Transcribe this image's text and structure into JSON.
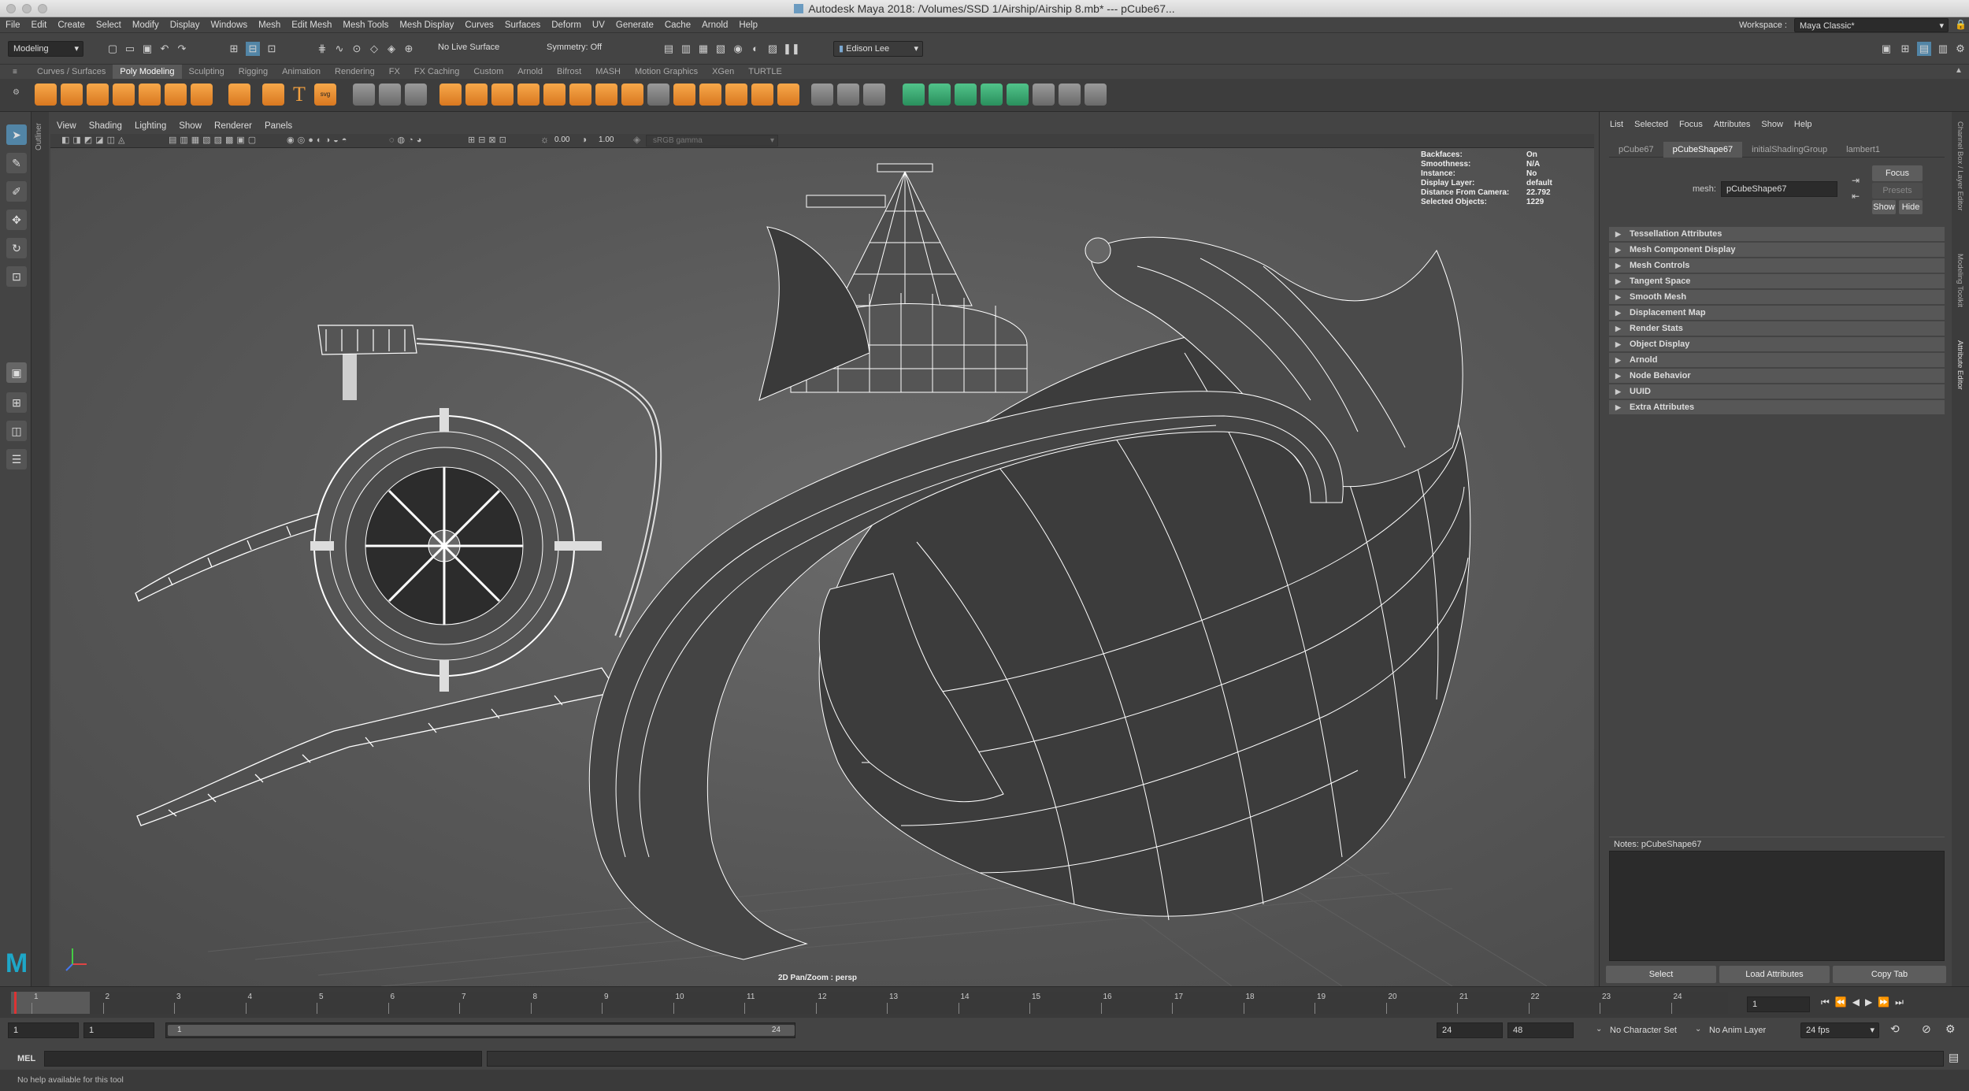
{
  "window": {
    "title": "Autodesk Maya 2018: /Volumes/SSD 1/Airship/Airship 8.mb*   ---   pCube67..."
  },
  "menubar": [
    "File",
    "Edit",
    "Create",
    "Select",
    "Modify",
    "Display",
    "Windows",
    "Mesh",
    "Edit Mesh",
    "Mesh Tools",
    "Mesh Display",
    "Curves",
    "Surfaces",
    "Deform",
    "UV",
    "Generate",
    "Cache",
    "Arnold",
    "Help"
  ],
  "workspace": {
    "label": "Workspace :",
    "value": "Maya Classic*"
  },
  "statusline": {
    "mode": "Modeling",
    "live_surface": "No Live Surface",
    "symmetry": "Symmetry: Off",
    "user": "Edison Lee"
  },
  "shelf_tabs": [
    "Curves / Surfaces",
    "Poly Modeling",
    "Sculpting",
    "Rigging",
    "Animation",
    "Rendering",
    "FX",
    "FX Caching",
    "Custom",
    "Arnold",
    "Bifrost",
    "MASH",
    "Motion Graphics",
    "XGen",
    "TURTLE"
  ],
  "active_shelf": "Poly Modeling",
  "outliner_tab": "Outliner",
  "viewport": {
    "menu": [
      "View",
      "Shading",
      "Lighting",
      "Show",
      "Renderer",
      "Panels"
    ],
    "exposure": "0.00",
    "gamma": "1.00",
    "color_space": "sRGB gamma",
    "camera_label": "2D Pan/Zoom : persp",
    "hud": [
      {
        "label": "Backfaces:",
        "value": "On"
      },
      {
        "label": "Smoothness:",
        "value": "N/A"
      },
      {
        "label": "Instance:",
        "value": "No"
      },
      {
        "label": "Display Layer:",
        "value": "default"
      },
      {
        "label": "Distance From Camera:",
        "value": "22.792"
      },
      {
        "label": "Selected Objects:",
        "value": "1229"
      }
    ]
  },
  "attribute_editor": {
    "menu": [
      "List",
      "Selected",
      "Focus",
      "Attributes",
      "Show",
      "Help"
    ],
    "tabs": [
      "pCube67",
      "pCubeShape67",
      "initialShadingGroup",
      "lambert1"
    ],
    "active_tab": "pCubeShape67",
    "mesh_label": "mesh:",
    "mesh_value": "pCubeShape67",
    "focus_btn": "Focus",
    "presets_btn": "Presets",
    "show_btn": "Show",
    "hide_btn": "Hide",
    "sections": [
      "Tessellation Attributes",
      "Mesh Component Display",
      "Mesh Controls",
      "Tangent Space",
      "Smooth Mesh",
      "Displacement Map",
      "Render Stats",
      "Object Display",
      "Arnold",
      "Node Behavior",
      "UUID",
      "Extra Attributes"
    ],
    "notes_label": "Notes:  pCubeShape67",
    "buttons": [
      "Select",
      "Load Attributes",
      "Copy Tab"
    ]
  },
  "side_tabs": [
    "Channel Box / Layer Editor",
    "Modeling Toolkit",
    "Attribute Editor"
  ],
  "time_slider": {
    "ticks": [
      "1",
      "2",
      "3",
      "4",
      "5",
      "6",
      "7",
      "8",
      "9",
      "10",
      "11",
      "12",
      "13",
      "14",
      "15",
      "16",
      "17",
      "18",
      "19",
      "20",
      "21",
      "22",
      "23",
      "24"
    ],
    "current_frame": "1"
  },
  "range_slider": {
    "start": "1",
    "playback_start": "1",
    "range_start": "1",
    "range_end": "24",
    "playback_end": "24",
    "end": "48",
    "character_set": "No Character Set",
    "anim_layer": "No Anim Layer",
    "fps": "24 fps"
  },
  "command_line": {
    "label": "MEL"
  },
  "help_line": "No help available for this tool"
}
